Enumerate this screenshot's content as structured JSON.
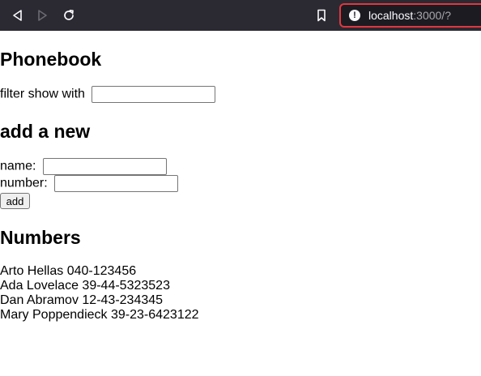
{
  "browser": {
    "url_host": "localhost",
    "url_rest": ":3000/?",
    "info_icon": "!",
    "icons": [
      "back-icon",
      "forward-icon",
      "reload-icon",
      "bookmark-icon",
      "info-icon"
    ]
  },
  "page": {
    "title": "Phonebook",
    "filter_label": "filter show with",
    "filter_value": "",
    "add_title": "add a new",
    "name_label": "name:",
    "name_value": "",
    "number_label": "number:",
    "number_value": "",
    "add_button_label": "add",
    "numbers_title": "Numbers",
    "persons": [
      {
        "name": "Arto Hellas",
        "number": "040-123456"
      },
      {
        "name": "Ada Lovelace",
        "number": "39-44-5323523"
      },
      {
        "name": "Dan Abramov",
        "number": "12-43-234345"
      },
      {
        "name": "Mary Poppendieck",
        "number": "39-23-6423122"
      }
    ]
  },
  "colors": {
    "toolbar_bg": "#2b2a33",
    "urlbar_bg": "#1c1b22",
    "urlbar_border": "#e0373f",
    "icon_active": "#fbfbfe",
    "icon_disabled": "#6b6a73"
  }
}
